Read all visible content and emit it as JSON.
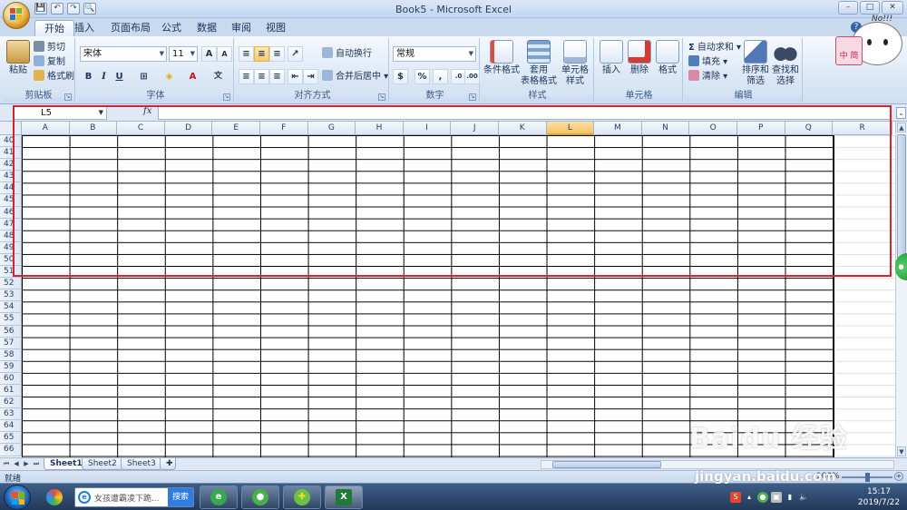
{
  "window": {
    "title": "Book5 - Microsoft Excel",
    "buttons": [
      "–",
      "□",
      "✕"
    ]
  },
  "qat": {
    "items": [
      "💾",
      "↶",
      "↷",
      "🔍"
    ]
  },
  "tabs": [
    {
      "label": "开始",
      "active": true
    },
    {
      "label": "插入"
    },
    {
      "label": "页面布局"
    },
    {
      "label": "公式"
    },
    {
      "label": "数据"
    },
    {
      "label": "审阅"
    },
    {
      "label": "视图"
    }
  ],
  "ribbon": {
    "clipboard": {
      "label": "剪贴板",
      "paste": "粘贴",
      "cut": "剪切",
      "copy": "复制",
      "format_painter": "格式刷"
    },
    "font": {
      "label": "字体",
      "font_name": "宋体",
      "font_size": "11",
      "bold": "B",
      "italic": "I",
      "underline": "U"
    },
    "alignment": {
      "label": "对齐方式",
      "wrap_text": "自动换行",
      "merge_center": "合并后居中"
    },
    "number": {
      "label": "数字",
      "format": "常规",
      "percent": "%",
      "comma": ","
    },
    "styles": {
      "label": "样式",
      "conditional": "条件格式",
      "table_format_1": "套用",
      "table_format_2": "表格格式",
      "cell_styles_1": "单元格",
      "cell_styles_2": "样式"
    },
    "cells": {
      "label": "单元格",
      "insert": "插入",
      "delete": "删除",
      "format": "格式"
    },
    "editing": {
      "label": "编辑",
      "autosum": "自动求和",
      "fill": "填充",
      "clear": "清除",
      "sort_1": "排序和",
      "sort_2": "筛选",
      "find_1": "查找和",
      "find_2": "选择"
    }
  },
  "mascot": {
    "text": "No!!!",
    "badge": "中 简"
  },
  "formula_bar": {
    "name_box": "L5",
    "fx": "fx",
    "value": ""
  },
  "columns": [
    "A",
    "B",
    "C",
    "D",
    "E",
    "F",
    "G",
    "H",
    "I",
    "J",
    "K",
    "L",
    "M",
    "N",
    "O",
    "P",
    "Q",
    "R"
  ],
  "selected_column": "L",
  "rows": [
    "40",
    "41",
    "42",
    "43",
    "44",
    "45",
    "46",
    "47",
    "48",
    "49",
    "50",
    "51",
    "52",
    "53",
    "54",
    "55",
    "56",
    "57",
    "58",
    "59",
    "60",
    "61",
    "62",
    "63",
    "64",
    "65",
    "66"
  ],
  "sheets": [
    "Sheet1",
    "Sheet2",
    "Sheet3"
  ],
  "status": {
    "ready": "就绪",
    "zoom": "100%"
  },
  "taskbar": {
    "search_text": "女孩遭霸凌下跪...",
    "search_button": "搜索",
    "time": "15:17",
    "date": "2019/7/22"
  },
  "watermark": {
    "brand": "Baidu 经验",
    "url": "jingyan.baidu.com"
  },
  "colors": {
    "highlight": "#d7232b",
    "selected_header": "#f6c362",
    "ribbon_bg": "#dde8f6"
  }
}
